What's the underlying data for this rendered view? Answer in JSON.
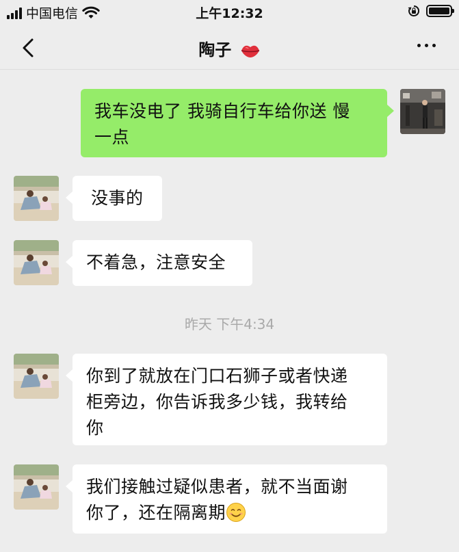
{
  "status_bar": {
    "carrier": "中国电信",
    "time": "上午12:32"
  },
  "nav": {
    "title": "陶子",
    "back_icon": "chevron-left-icon",
    "title_icon": "kiss-lips-icon",
    "more_icon": "more-dots-icon"
  },
  "messages": [
    {
      "side": "out",
      "text_line1": "我车没电了 我骑自行车给你送 慢",
      "text_line2": "一点"
    },
    {
      "side": "in",
      "text": "没事的"
    },
    {
      "side": "in",
      "text": "不着急，注意安全"
    },
    {
      "side": "in",
      "text_line1": "你到了就放在门口石狮子或者快递",
      "text_line2": "柜旁边，你告诉我多少钱，我转给",
      "text_line3": "你"
    },
    {
      "side": "in",
      "text_line1": "我们接触过疑似患者，就不当面谢",
      "text_line2": "你了，还在隔离期",
      "emoji": "smiling-face-icon"
    }
  ],
  "timestamp": "昨天 下午4:34",
  "colors": {
    "background": "#ededed",
    "outgoing_bubble": "#95ec69",
    "incoming_bubble": "#ffffff",
    "timestamp_text": "#a9a9a9"
  }
}
